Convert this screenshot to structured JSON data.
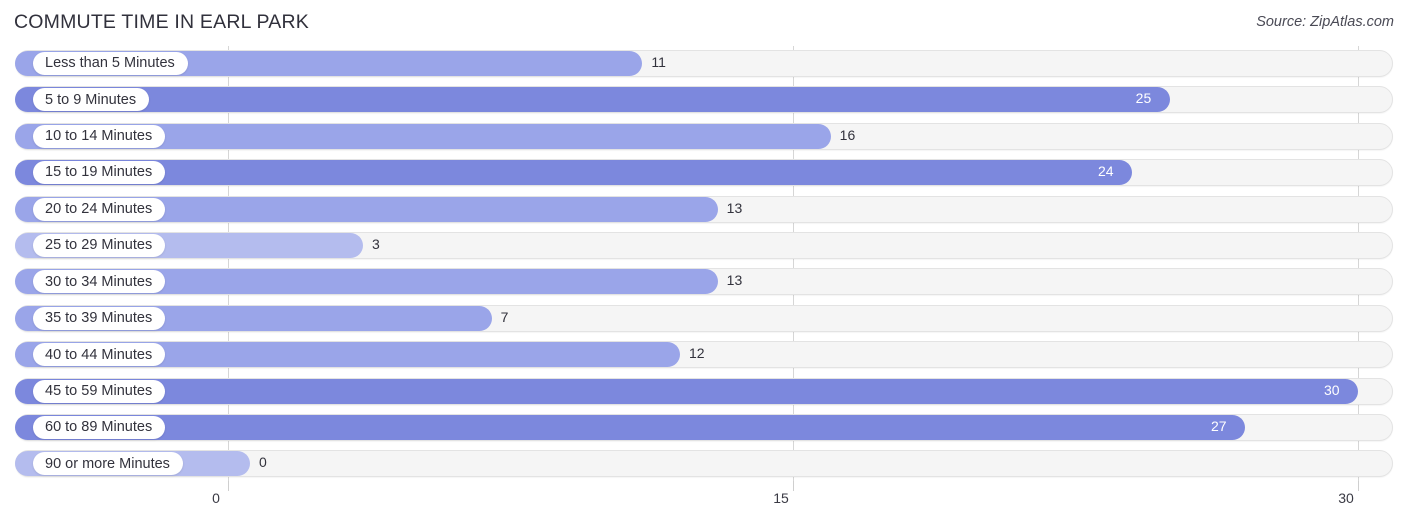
{
  "header": {
    "title": "COMMUTE TIME IN EARL PARK",
    "source": "Source: ZipAtlas.com"
  },
  "colors": {
    "bar_dark": "#7c88dd",
    "bar_light": "#9aa5e9",
    "bar_pale": "#b4bcee",
    "track": "#f5f5f5",
    "gridline": "#d6d6d6",
    "text": "#32323c"
  },
  "axis": {
    "ticks": [
      {
        "label": "0",
        "value": 0
      },
      {
        "label": "15",
        "value": 15
      },
      {
        "label": "30",
        "value": 30
      }
    ]
  },
  "chart_data": {
    "type": "bar",
    "orientation": "horizontal",
    "title": "COMMUTE TIME IN EARL PARK",
    "subtitle": "",
    "xlabel": "",
    "ylabel": "",
    "xlim": [
      0,
      30
    ],
    "grid": true,
    "legend": "none",
    "categories": [
      "Less than 5 Minutes",
      "5 to 9 Minutes",
      "10 to 14 Minutes",
      "15 to 19 Minutes",
      "20 to 24 Minutes",
      "25 to 29 Minutes",
      "30 to 34 Minutes",
      "35 to 39 Minutes",
      "40 to 44 Minutes",
      "45 to 59 Minutes",
      "60 to 89 Minutes",
      "90 or more Minutes"
    ],
    "values": [
      11,
      25,
      16,
      24,
      13,
      3,
      13,
      7,
      12,
      30,
      27,
      0
    ],
    "value_labels": [
      "11",
      "25",
      "16",
      "24",
      "13",
      "3",
      "13",
      "7",
      "12",
      "30",
      "27",
      "0"
    ],
    "source": "Source: ZipAtlas.com"
  },
  "rows": [
    {
      "label": "Less than 5 Minutes",
      "value": 11,
      "value_label": "11",
      "shade": "light",
      "label_inside": false
    },
    {
      "label": "5 to 9 Minutes",
      "value": 25,
      "value_label": "25",
      "shade": "dark",
      "label_inside": true
    },
    {
      "label": "10 to 14 Minutes",
      "value": 16,
      "value_label": "16",
      "shade": "light",
      "label_inside": false
    },
    {
      "label": "15 to 19 Minutes",
      "value": 24,
      "value_label": "24",
      "shade": "dark",
      "label_inside": true
    },
    {
      "label": "20 to 24 Minutes",
      "value": 13,
      "value_label": "13",
      "shade": "light",
      "label_inside": false
    },
    {
      "label": "25 to 29 Minutes",
      "value": 3,
      "value_label": "3",
      "shade": "pale",
      "label_inside": false
    },
    {
      "label": "30 to 34 Minutes",
      "value": 13,
      "value_label": "13",
      "shade": "light",
      "label_inside": false
    },
    {
      "label": "35 to 39 Minutes",
      "value": 7,
      "value_label": "7",
      "shade": "light",
      "label_inside": false
    },
    {
      "label": "40 to 44 Minutes",
      "value": 12,
      "value_label": "12",
      "shade": "light",
      "label_inside": false
    },
    {
      "label": "45 to 59 Minutes",
      "value": 30,
      "value_label": "30",
      "shade": "dark",
      "label_inside": true
    },
    {
      "label": "60 to 89 Minutes",
      "value": 27,
      "value_label": "27",
      "shade": "dark",
      "label_inside": true
    },
    {
      "label": "90 or more Minutes",
      "value": 0,
      "value_label": "0",
      "shade": "pale",
      "label_inside": false
    }
  ]
}
